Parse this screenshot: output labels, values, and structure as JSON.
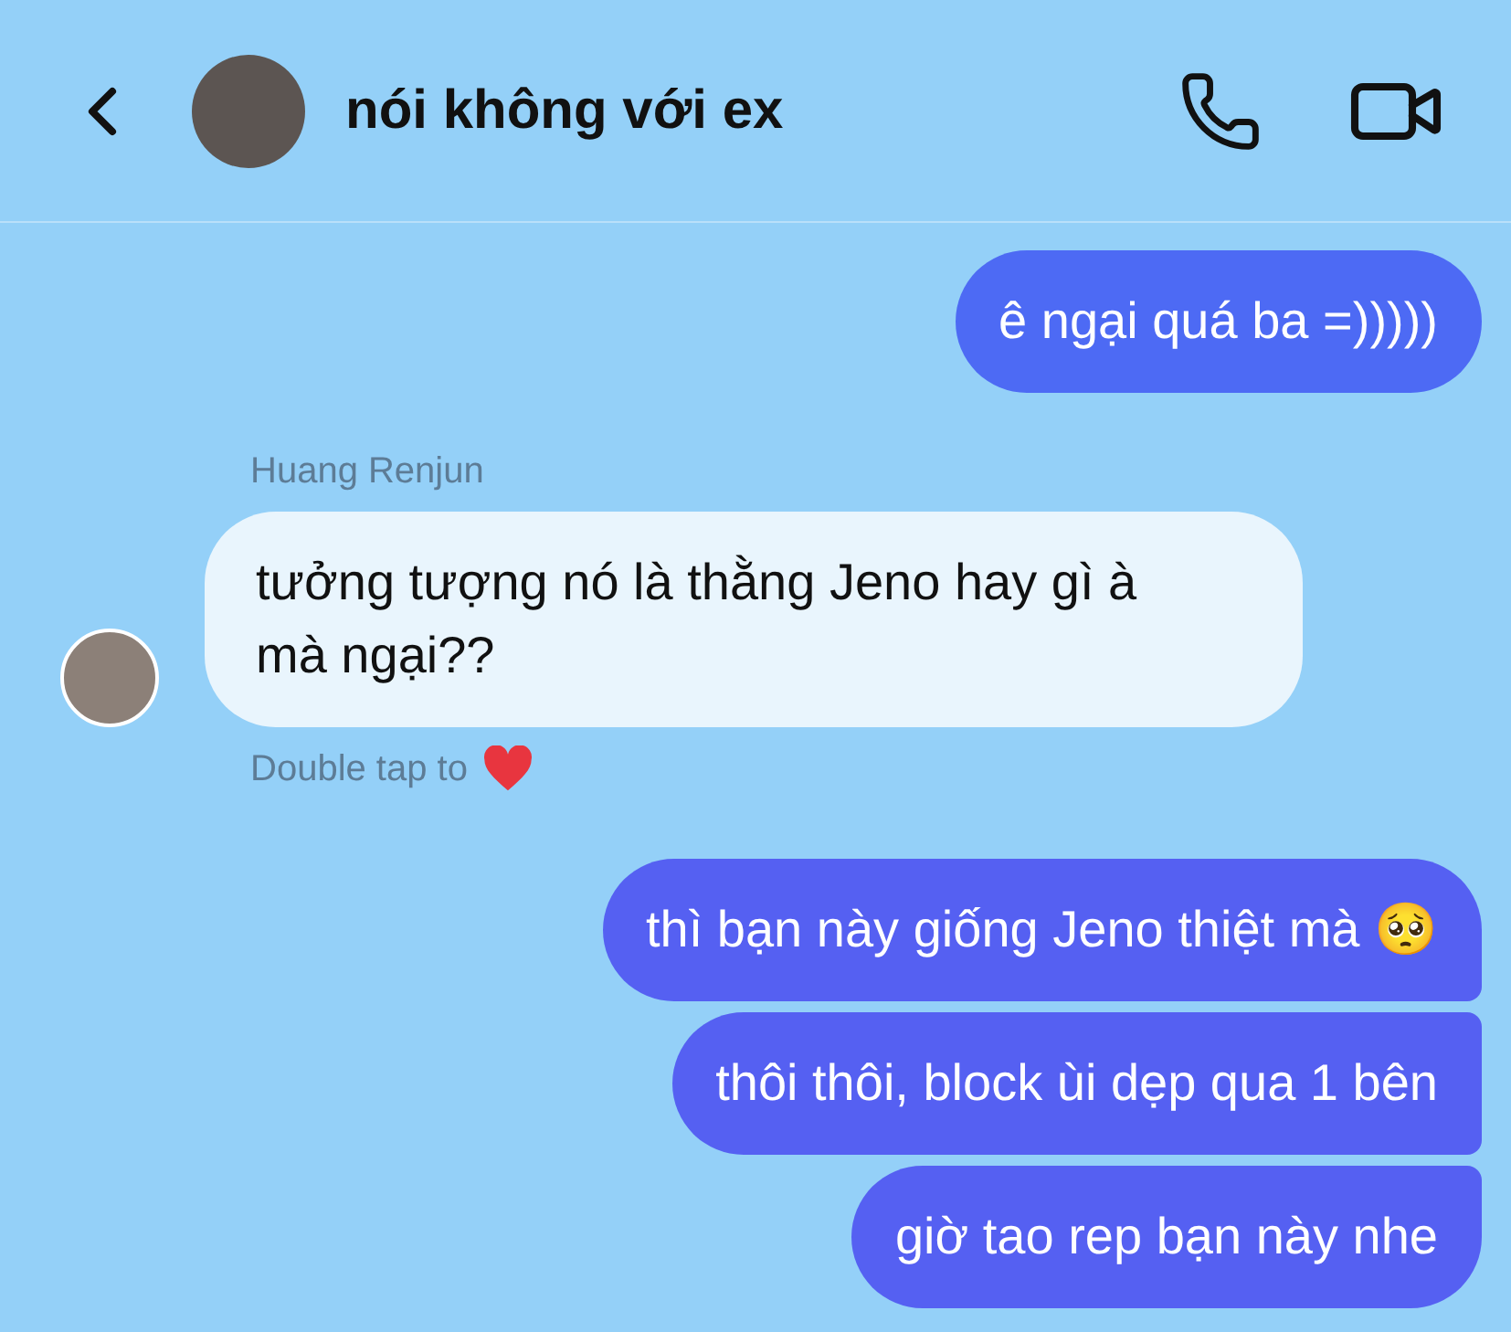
{
  "header": {
    "title": "nói không với ex"
  },
  "messages": [
    {
      "kind": "outgoing",
      "text": "ê ngại quá ba =)))))"
    },
    {
      "kind": "sender_name",
      "text": "Huang Renjun"
    },
    {
      "kind": "incoming",
      "text": "tưởng tượng nó là thằng Jeno hay gì à mà ngại??"
    },
    {
      "kind": "hint",
      "text": "Double tap to"
    },
    {
      "kind": "outgoing_group",
      "texts": [
        "thì bạn này giống Jeno thiệt mà 🥺",
        "thôi thôi, block ùi dẹp qua 1 bên",
        "giờ tao rep bạn này nhe"
      ]
    }
  ]
}
